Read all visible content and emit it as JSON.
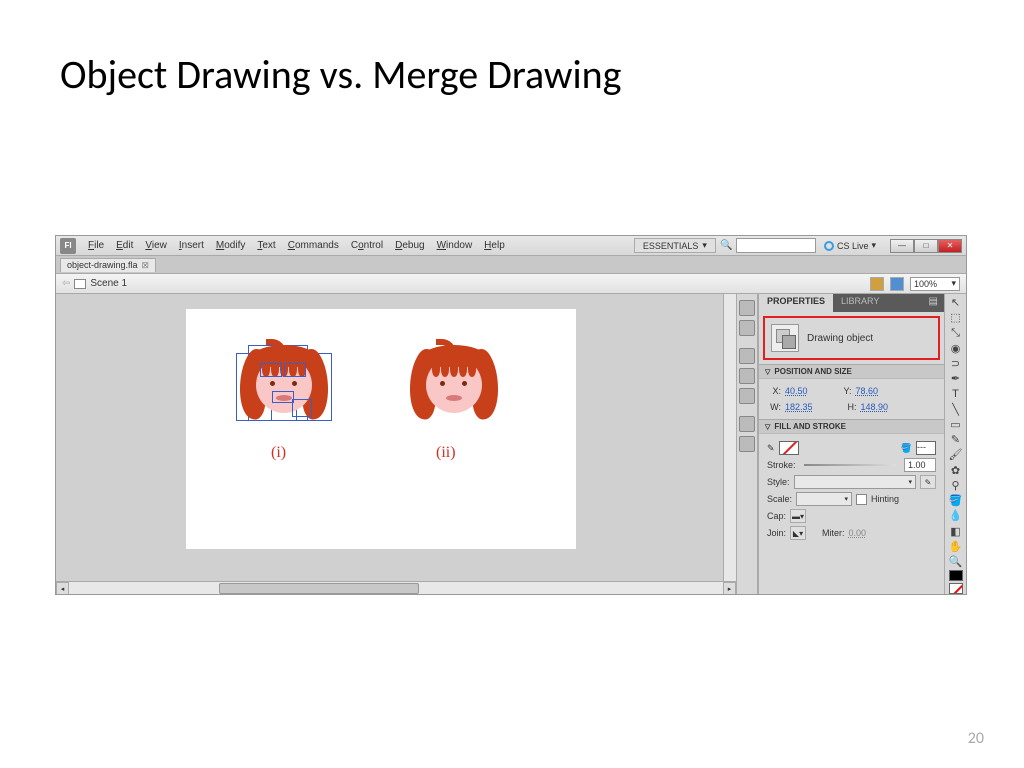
{
  "slide": {
    "title": "Object Drawing vs. Merge Drawing",
    "page": "20"
  },
  "menubar": {
    "logo": "Fl",
    "items": [
      "File",
      "Edit",
      "View",
      "Insert",
      "Modify",
      "Text",
      "Commands",
      "Control",
      "Debug",
      "Window",
      "Help"
    ],
    "workspace": "ESSENTIALS",
    "cslive": "CS Live"
  },
  "document": {
    "tab": "object-drawing.fla",
    "scene": "Scene 1",
    "zoom": "100%"
  },
  "canvas": {
    "label_i": "(i)",
    "label_ii": "(ii)"
  },
  "panel": {
    "tabs": {
      "properties": "PROPERTIES",
      "library": "LIBRARY"
    },
    "object_type": "Drawing object",
    "section_pos": "POSITION AND SIZE",
    "pos": {
      "x_label": "X:",
      "x": "40.50",
      "y_label": "Y:",
      "y": "78.60",
      "w_label": "W:",
      "w": "182.35",
      "h_label": "H:",
      "h": "148.90"
    },
    "section_fill": "FILL AND STROKE",
    "stroke_label": "Stroke:",
    "stroke_val": "1.00",
    "style_label": "Style:",
    "scale_label": "Scale:",
    "hinting_label": "Hinting",
    "cap_label": "Cap:",
    "join_label": "Join:",
    "miter_label": "Miter:",
    "miter_val": "0.00"
  }
}
